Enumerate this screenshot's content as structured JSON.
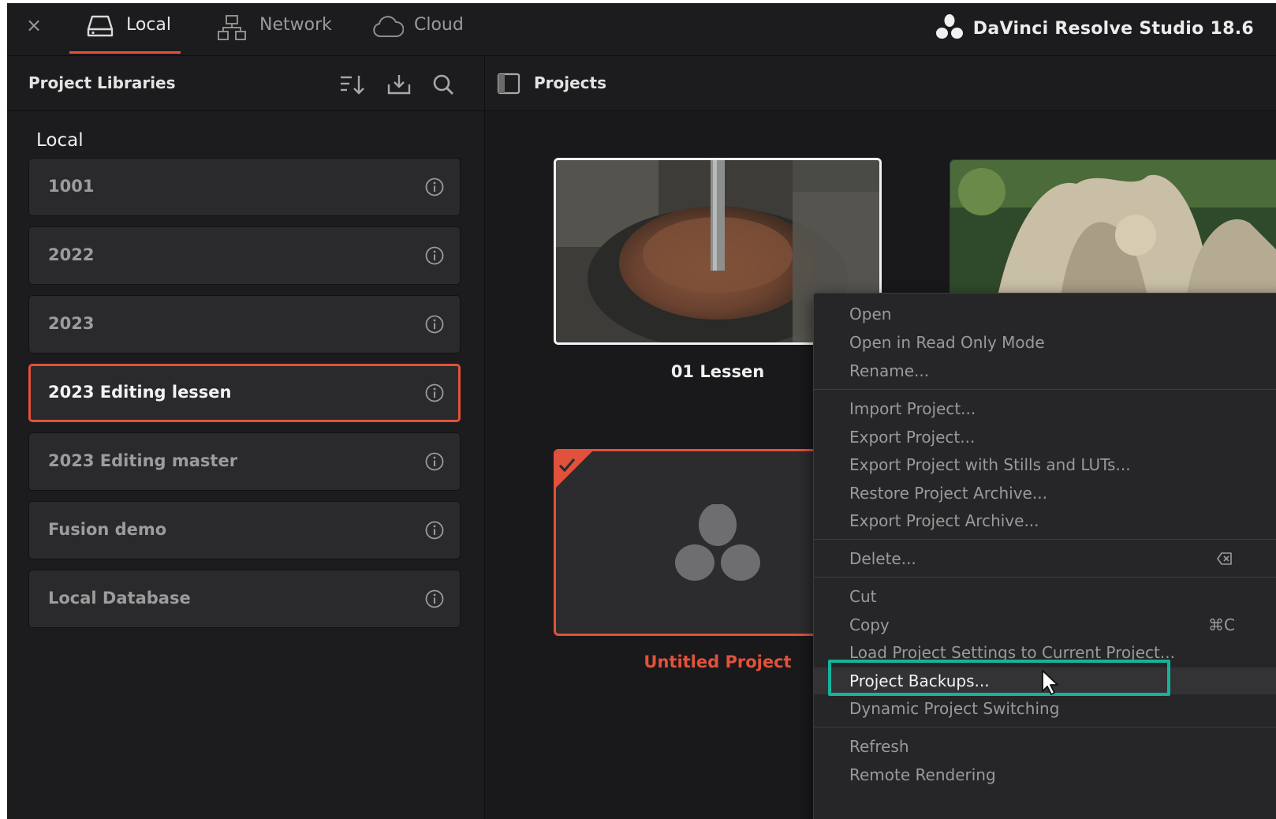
{
  "topbar": {
    "close": "×",
    "tabs": [
      {
        "label": "Local",
        "icon": "hard-drive-icon",
        "active": true
      },
      {
        "label": "Network",
        "icon": "network-icon",
        "active": false
      },
      {
        "label": "Cloud",
        "icon": "cloud-icon",
        "active": false
      }
    ],
    "brand": "DaVinci Resolve Studio 18.6",
    "brand_icon": "davinci-logo-icon"
  },
  "left_panel": {
    "title": "Project Libraries",
    "icons": [
      "sort-icon",
      "import-icon",
      "search-icon"
    ],
    "section": "Local",
    "libraries": [
      {
        "name": "1001",
        "selected": false
      },
      {
        "name": "2022",
        "selected": false
      },
      {
        "name": "2023",
        "selected": false
      },
      {
        "name": "2023 Editing lessen",
        "selected": true
      },
      {
        "name": "2023 Editing master",
        "selected": false
      },
      {
        "name": "Fusion demo",
        "selected": false
      },
      {
        "name": "Local Database",
        "selected": false
      }
    ]
  },
  "right_panel": {
    "title": "Projects",
    "icon": "sidebar-toggle-icon",
    "projects": [
      {
        "name": "01 Lessen",
        "thumbnail": "coffee-grinder-photo"
      },
      {
        "name": "",
        "thumbnail": "statue-photo"
      },
      {
        "name": "Untitled Project",
        "thumbnail": "davinci-placeholder-icon",
        "current": true
      }
    ]
  },
  "context_menu": {
    "groups": [
      [
        {
          "label": "Open"
        },
        {
          "label": "Open in Read Only Mode"
        },
        {
          "label": "Rename..."
        }
      ],
      [
        {
          "label": "Import Project..."
        },
        {
          "label": "Export Project..."
        },
        {
          "label": "Export Project with Stills and LUTs..."
        },
        {
          "label": "Restore Project Archive..."
        },
        {
          "label": "Export Project Archive..."
        }
      ],
      [
        {
          "label": "Delete...",
          "shortcut_icon": "delete-key-icon"
        }
      ],
      [
        {
          "label": "Cut"
        },
        {
          "label": "Copy",
          "shortcut": "⌘C"
        },
        {
          "label": "Load Project Settings to Current Project..."
        },
        {
          "label": "Project Backups...",
          "highlighted": true
        },
        {
          "label": "Dynamic Project Switching"
        }
      ],
      [
        {
          "label": "Refresh"
        },
        {
          "label": "Remote Rendering"
        }
      ]
    ]
  },
  "colors": {
    "accent": "#e2513b",
    "highlight": "#16b39b",
    "background": "#1c1c1e"
  }
}
